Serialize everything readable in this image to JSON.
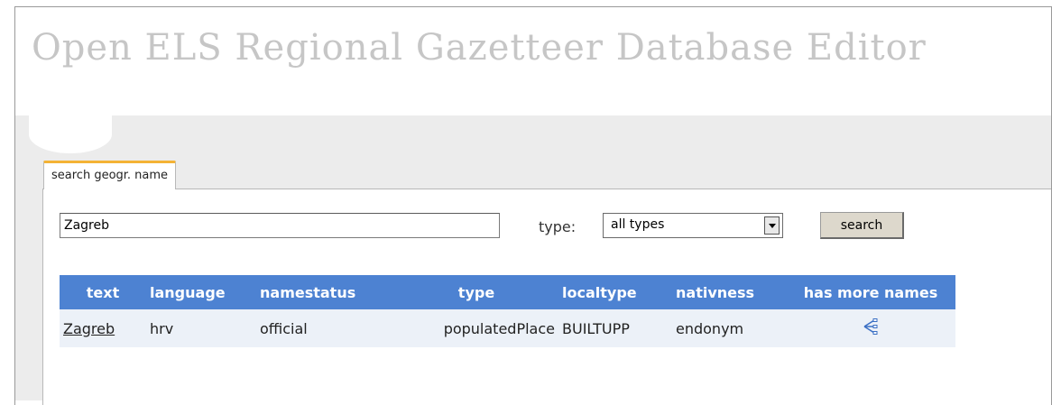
{
  "app": {
    "title": "Open ELS Regional Gazetteer Database Editor"
  },
  "tabs": [
    {
      "label": "search geogr. name",
      "active": true
    }
  ],
  "search": {
    "query": "Zagreb",
    "type_label": "type:",
    "type_selected": "all types",
    "button_label": "search"
  },
  "table": {
    "headers": [
      "text",
      "language",
      "namestatus",
      "type",
      "localtype",
      "nativness",
      "has more names"
    ],
    "rows": [
      {
        "text": "Zagreb",
        "language": "hrv",
        "namestatus": "official",
        "type": "populatedPlace",
        "localtype": "BUILTUPP",
        "nativness": "endonym",
        "has_more_names_icon": "tree-branch-icon"
      }
    ]
  },
  "colors": {
    "header_bg": "#4d82d2",
    "row_bg": "#ecf1f8",
    "tab_accent": "#f4b335",
    "title_text": "#c6c6c6"
  }
}
